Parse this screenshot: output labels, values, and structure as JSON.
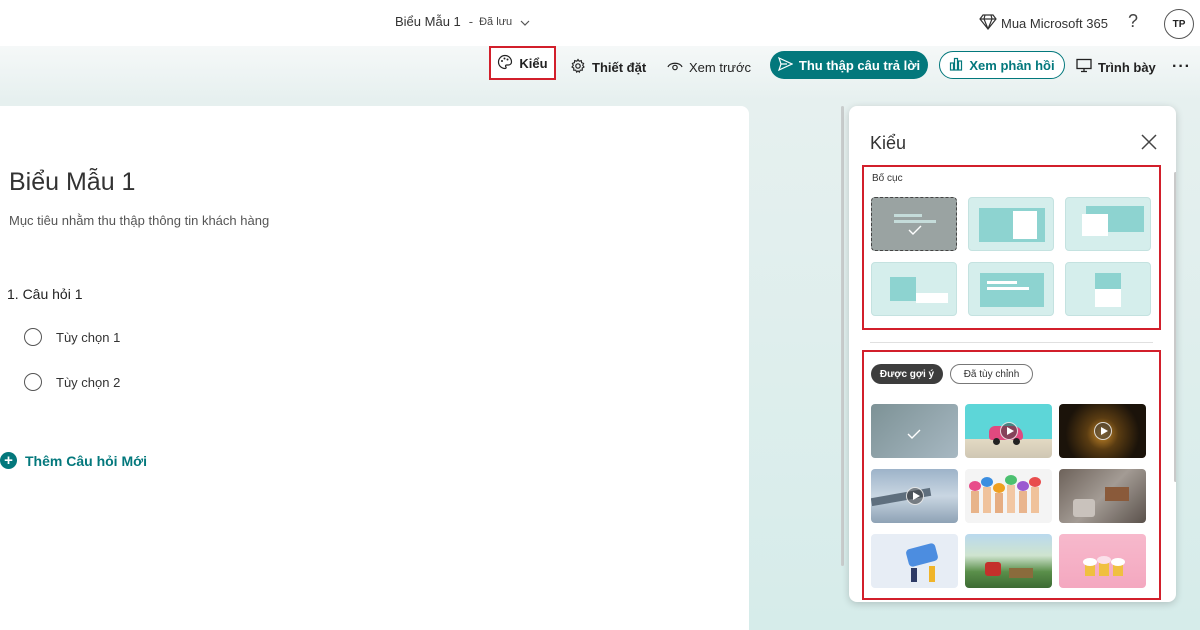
{
  "header": {
    "form_name": "Biểu Mẫu 1",
    "separator": "-",
    "saved_status": "Đã lưu",
    "buy_label": "Mua Microsoft 365",
    "help_label": "?",
    "avatar_initials": "TP"
  },
  "toolbar": {
    "style_label": "Kiểu",
    "settings_label": "Thiết đặt",
    "preview_label": "Xem trước",
    "collect_label": "Thu thập câu trả lời",
    "responses_label": "Xem phản hồi",
    "present_label": "Trình bày",
    "more_label": "···"
  },
  "form": {
    "title": "Biểu Mẫu 1",
    "description": "Mục tiêu nhằm thu thập thông tin khách hàng",
    "question": "1. Câu hỏi 1",
    "options": [
      "Tùy chọn 1",
      "Tùy chọn 2"
    ],
    "add_question_label": "Thêm Câu hỏi Mới"
  },
  "style_panel": {
    "title": "Kiểu",
    "layout_section_label": "Bố cục",
    "tabs": {
      "suggested": "Được gợi ý",
      "custom": "Đã tùy chỉnh"
    }
  },
  "colors": {
    "accent": "#03787c",
    "highlight_border": "#d21f2b"
  }
}
